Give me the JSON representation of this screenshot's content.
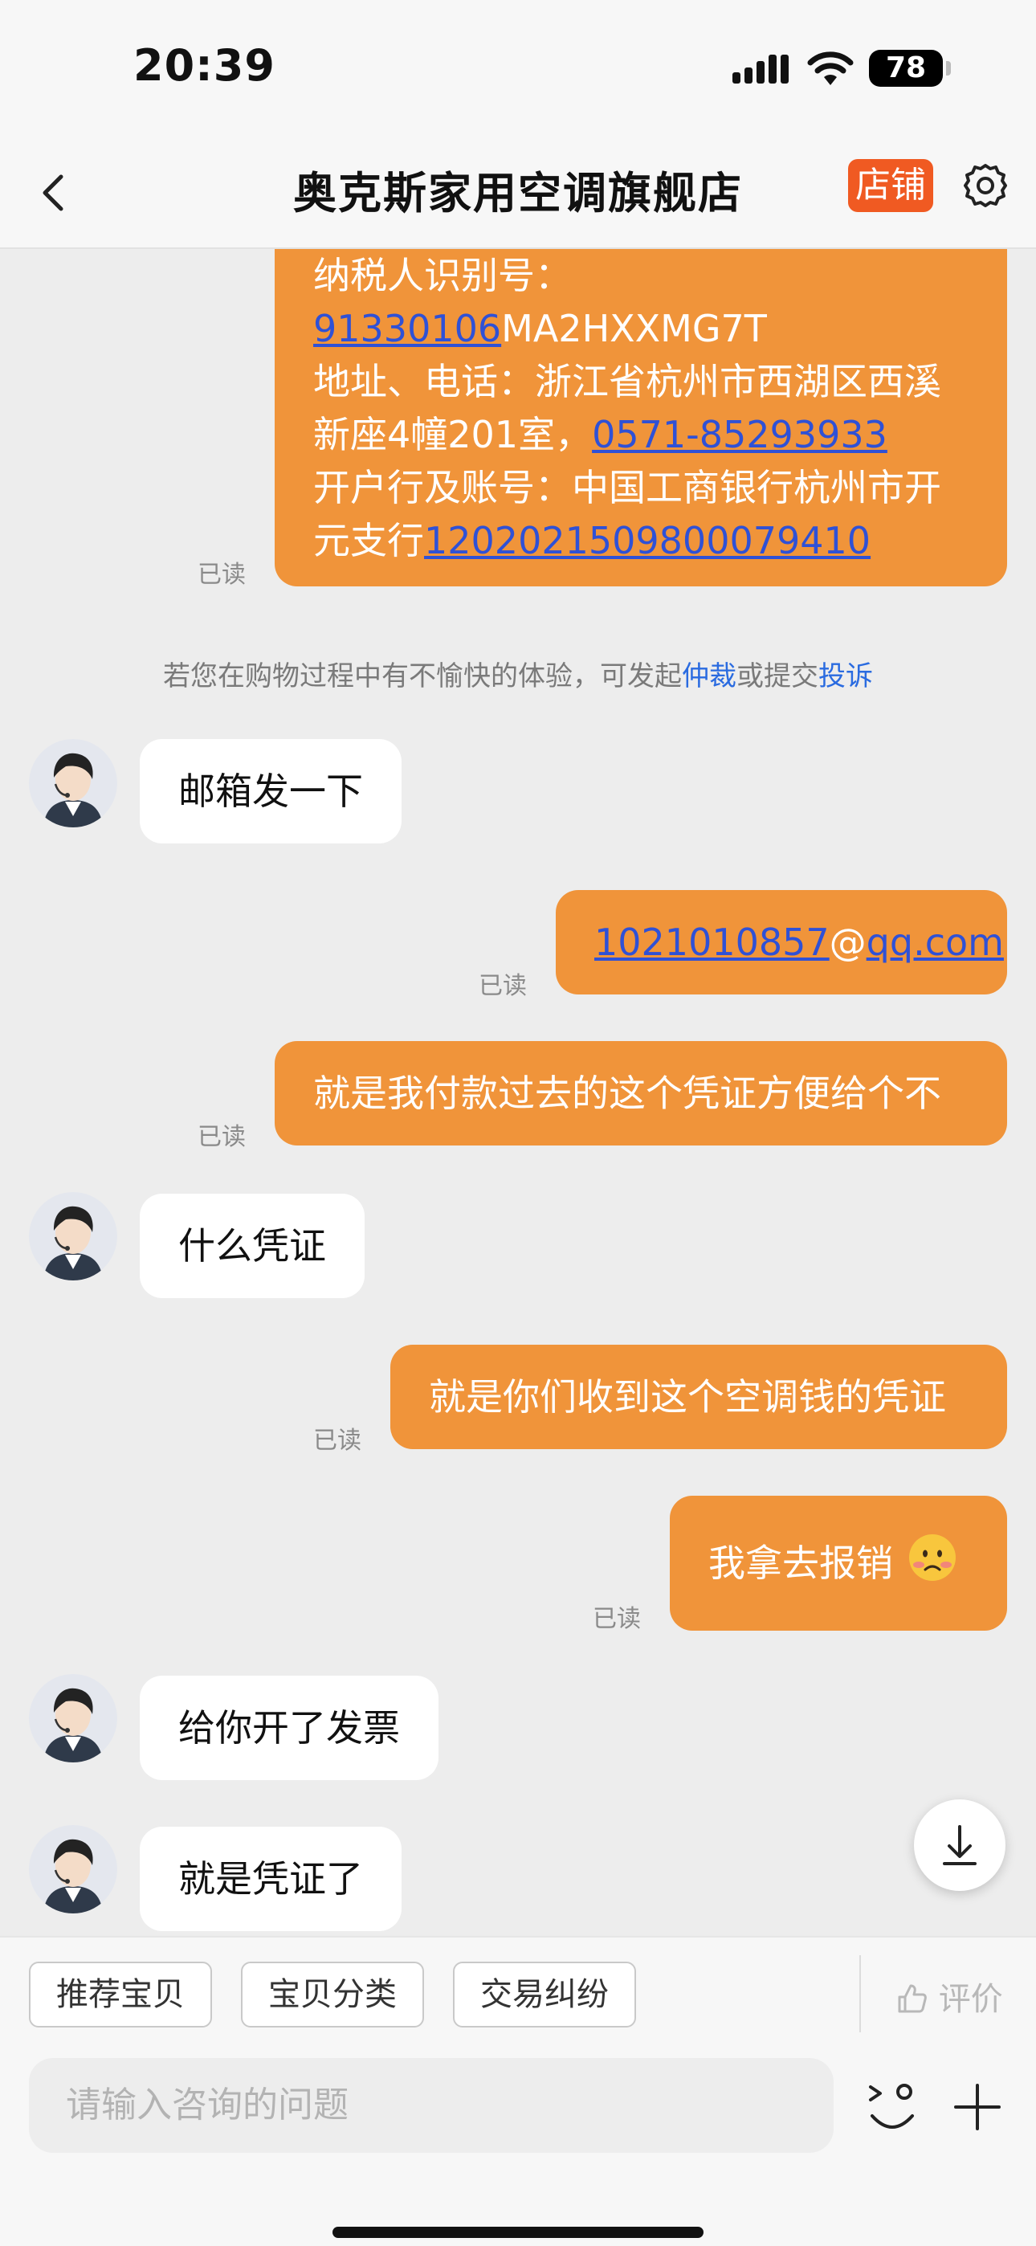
{
  "status_bar": {
    "time": "20:39",
    "battery": "78"
  },
  "nav": {
    "title": "奥克斯家用空调旗舰店",
    "shop_label": "店铺"
  },
  "messages": {
    "invoice": {
      "tax_label": "纳税人识别号：",
      "tax_id_link": "91330106",
      "tax_id_rest": "MA2HXXMG7T",
      "address_line1": "地址、电话：浙江省杭州市西湖区西溪",
      "address_line2_prefix": "新座4幢201室，",
      "phone": "0571-85293933",
      "bank_line1": "开户行及账号：中国工商银行杭州市开",
      "bank_line2_prefix": "元支行",
      "account": "1202021509800079410"
    },
    "read_label": "已读",
    "notice_prefix": "若您在购物过程中有不愉快的体验，可发起",
    "notice_arbitration": "仲裁",
    "notice_middle": "或提交",
    "notice_complaint": "投诉",
    "m1": "邮箱发一下",
    "m2_user": "1021010857",
    "m2_at": "@",
    "m2_domain": "qq.com",
    "m3": "就是我付款过去的这个凭证方便给个不",
    "m4": "什么凭证",
    "m5": "就是你们收到这个空调钱的凭证",
    "m6": "我拿去报销",
    "m6_emoji": "worried-face",
    "m7": "给你开了发票",
    "m8": "就是凭证了"
  },
  "bottom": {
    "quick_actions": [
      "推荐宝贝",
      "宝贝分类",
      "交易纠纷"
    ],
    "rate_label": "评价",
    "input_placeholder": "请输入咨询的问题"
  },
  "colors": {
    "outgoing_bubble": "#f0943a",
    "shop_badge": "#f05a22",
    "link": "#2f51d6",
    "notice_link": "#2a6be0"
  }
}
